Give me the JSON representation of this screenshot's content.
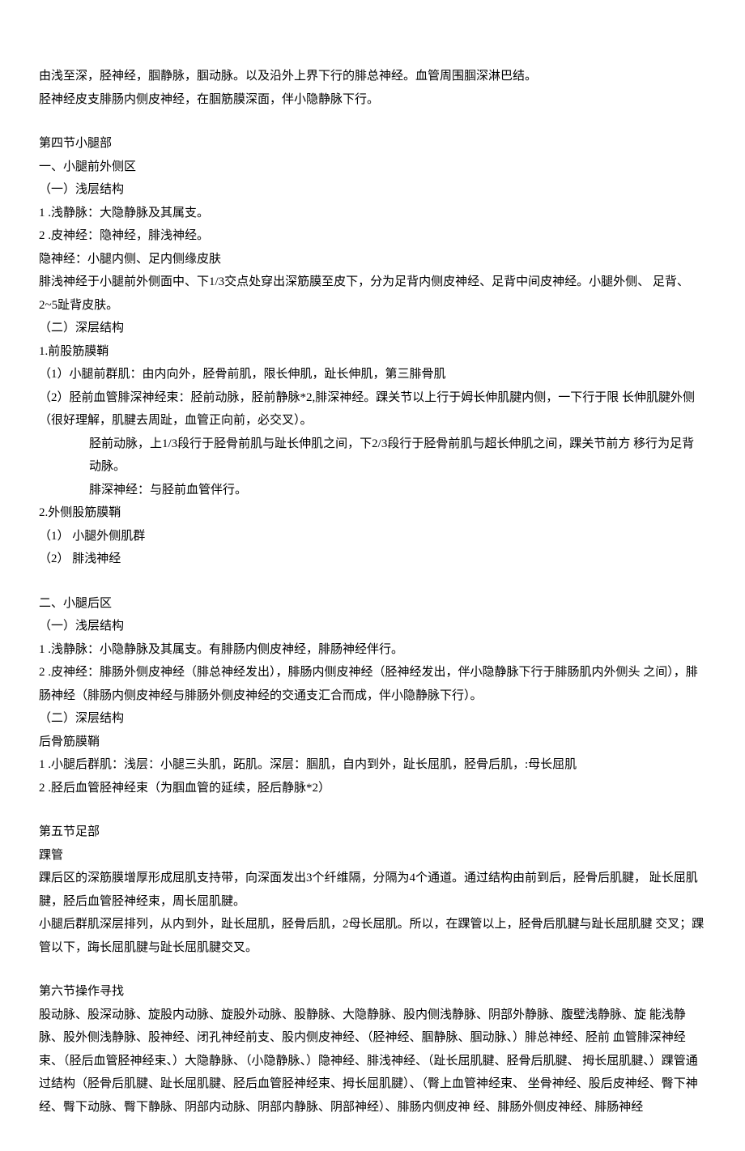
{
  "intro": {
    "l1": "由浅至深，胫神经，腘静脉，腘动脉。以及沿外上界下行的腓总神经。血管周围腘深淋巴结。",
    "l2": "胫神经皮支腓肠内侧皮神经，在腘筋膜深面，伴小隐静脉下行。"
  },
  "s4": {
    "title": "第四节小腿部",
    "a": {
      "h": "一、小腿前外侧区",
      "s1": {
        "h": "（一）浅层结构",
        "i1": "1 .浅静脉：大隐静脉及其属支。",
        "i2": "2 .皮神经：隐神经，腓浅神经。",
        "p1": "隐神经：小腿内侧、足内侧缘皮肤",
        "p2": "腓浅神经于小腿前外侧面中、下1/3交点处穿出深筋膜至皮下，分为足背内侧皮神经、足背中间皮神经。小腿外侧、 足背、2~5趾背皮肤。"
      },
      "s2": {
        "h": "（二）深层结构",
        "g1": {
          "h": "1.前股筋膜鞘",
          "i1": "（1）小腿前群肌：由内向外，胫骨前肌，限长伸肌，趾长伸肌，第三腓骨肌",
          "i2": "（2）胫前血管腓深神经束：胫前动脉，胫前静脉*2,腓深神经。踝关节以上行于姆长伸肌腱内侧，一下行于限 长伸肌腱外侧（很好理解，肌腱去周趾，血管正向前，必交叉）。",
          "i3": "胫前动脉，上1/3段行于胫骨前肌与趾长伸肌之间，下2/3段行于胫骨前肌与超长伸肌之间，踝关节前方 移行为足背动脉。",
          "i4": "腓深神经：与胫前血管伴行。"
        },
        "g2": {
          "h": "2.外侧股筋膜鞘",
          "i1": "（1） 小腿外侧肌群",
          "i2": "（2） 腓浅神经"
        }
      }
    },
    "b": {
      "h": "二、小腿后区",
      "s1": {
        "h": "（一）浅层结构",
        "i1": "1 .浅静脉：小隐静脉及其属支。有腓肠内侧皮神经，腓肠神经伴行。",
        "i2": "2 .皮神经：腓肠外侧皮神经（腓总神经发出），腓肠内侧皮神经（胫神经发出，伴小隐静脉下行于腓肠肌内外侧头   之间），腓肠神经（腓肠内侧皮神经与腓肠外侧皮神经的交通支汇合而成，伴小隐静脉下行）。"
      },
      "s2": {
        "h": "（二）深层结构",
        "p1": "后骨筋膜鞘",
        "i1": "1 .小腿后群肌：浅层：小腿三头肌，跖肌。深层：腘肌，自内到外，趾长屈肌，胫骨后肌，:母长屈肌",
        "i2": "2  .胫后血管胫神经束（为腘血管的延续，胫后静脉*2）"
      }
    }
  },
  "s5": {
    "title": "第五节足部",
    "h": "踝管",
    "p1": "踝后区的深筋膜增厚形成屈肌支持带，向深面发出3个纤维隔，分隔为4个通道。通过结构由前到后，胫骨后肌腱， 趾长屈肌腱，胫后血管胫神经束，周长屈肌腱。",
    "p2": "小腿后群肌深层排列，从内到外，趾长屈肌，胫骨后肌，2母长屈肌。所以，在踝管以上，胫骨后肌腱与趾长屈肌腱 交叉；踝管以下，踇长屈肌腱与趾长屈肌腱交叉。"
  },
  "s6": {
    "title": "第六节操作寻找",
    "p1": "股动脉、股深动脉、旋股内动脉、旋股外动脉、股静脉、大隐静脉、股内侧浅静脉、阴部外静脉、腹壁浅静脉、旋 能浅静脉、股外侧浅静脉、股神经、闭孔神经前支、股内侧皮神经、（胫神经、腘静脉、腘动脉、）腓总神经、胫前 血管腓深神经束、（胫后血管胫神经束、）大隐静脉、（小隐静脉、）隐神经、腓浅神经、（趾长屈肌腱、胫骨后肌腱、 拇长屈肌腱、）踝管通过结构（胫骨后肌腱、趾长屈肌腱、胫后血管胫神经束、拇长屈肌腱）、（臀上血管神经束、 坐骨神经、股后皮神经、臀下神经、臀下动脉、臀下静脉、阴部内动脉、阴部内静脉、阴部神经）、腓肠内侧皮神 经、腓肠外侧皮神经、腓肠神经"
  }
}
